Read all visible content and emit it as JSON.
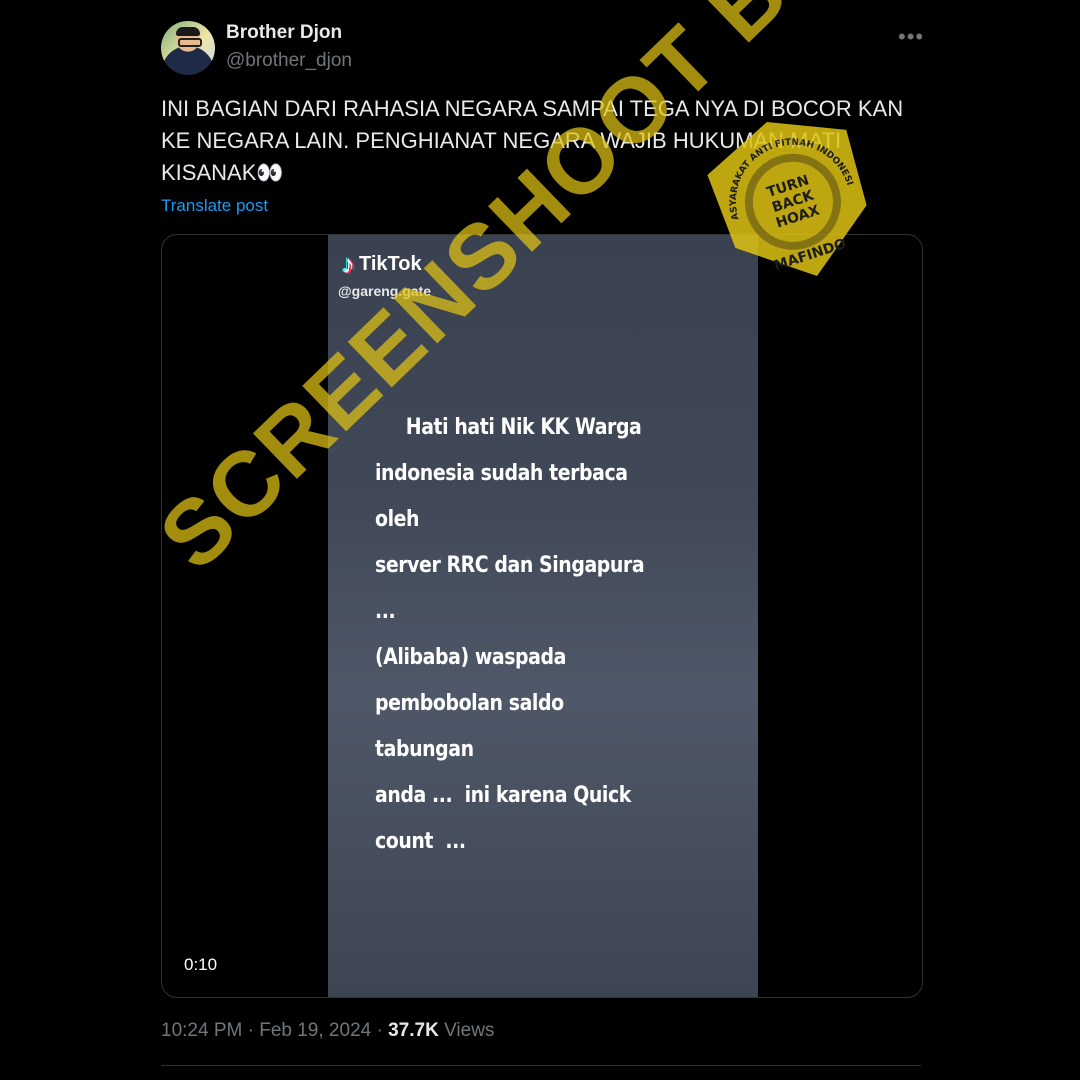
{
  "author": {
    "display_name": "Brother Djon",
    "handle": "@brother_djon"
  },
  "tweet": {
    "text": "INI BAGIAN DARI RAHASIA NEGARA SAMPAI TEGA NYA DI BOCOR KAN KE NEGARA LAIN. PENGHIANAT NEGARA WAJIB HUKUMAN MATI KISANAK👀",
    "translate_label": "Translate post",
    "more_icon": "more-options-icon"
  },
  "video": {
    "platform": "TikTok",
    "tiktok_user": "@gareng.gate",
    "caption": "     Hati hati Nik KK Warga\nindonesia sudah terbaca oleh\nserver RRC dan Singapura ...\n(Alibaba) waspada\npembobolan saldo tabungan\nanda ...  ini karena Quick\ncount  ...",
    "duration": "0:10"
  },
  "watermark": {
    "text": "SCREENSHOOT BY",
    "color": "#e0c414",
    "stamp_top": "MASYARAKAT ANTI FITNAH INDONESIA",
    "stamp_center": [
      "TURN",
      "BACK",
      "HOAX"
    ],
    "stamp_bottom": "MAFINDO"
  },
  "meta": {
    "time": "10:24 PM",
    "separator": "·",
    "date": "Feb 19, 2024",
    "views_count": "37.7K",
    "views_label": "Views"
  },
  "colors": {
    "background": "#000000",
    "text": "#e7e9ea",
    "secondary": "#71767b",
    "link": "#1d9bf0"
  }
}
